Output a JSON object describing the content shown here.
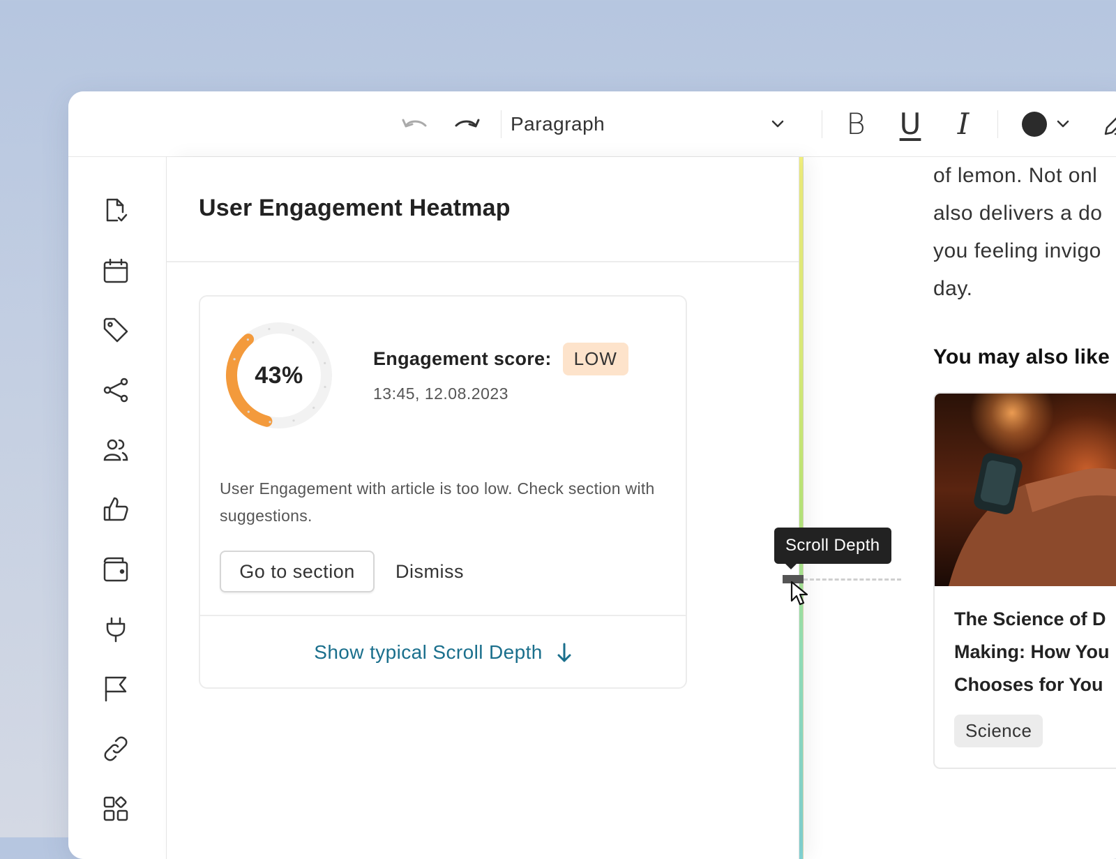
{
  "toolbar": {
    "paragraph_style": "Paragraph",
    "bold_label": "B",
    "underline_label": "U",
    "italic_label": "I",
    "text_color": "#2b2b2b"
  },
  "sidebar": {
    "items": [
      {
        "icon": "document-check-icon"
      },
      {
        "icon": "calendar-icon"
      },
      {
        "icon": "tag-icon"
      },
      {
        "icon": "share-icon"
      },
      {
        "icon": "users-icon"
      },
      {
        "icon": "thumbs-up-icon"
      },
      {
        "icon": "wallet-icon"
      },
      {
        "icon": "plug-icon"
      },
      {
        "icon": "flag-icon"
      },
      {
        "icon": "link-icon"
      },
      {
        "icon": "widgets-icon"
      }
    ]
  },
  "panel": {
    "title": "User Engagement Heatmap",
    "card": {
      "score_percent": 43,
      "score_display": "43%",
      "score_label": "Engagement score:",
      "score_level": "LOW",
      "timestamp": "13:45, 12.08.2023",
      "description": "User Engagement with article is too low. Check section with suggestions.",
      "primary_button": "Go to section",
      "secondary_button": "Dismiss",
      "link_label": "Show typical Scroll Depth",
      "accent_color": "#f39a3c"
    }
  },
  "scroll_depth": {
    "tooltip": "Scroll Depth"
  },
  "article": {
    "lines": [
      "of lemon. Not onl",
      "also delivers a do",
      "you feeling invigo",
      "day."
    ],
    "also_like_heading": "You may also like",
    "recommendation": {
      "title_lines": [
        "The Science of D",
        "Making: How You",
        "Chooses for You"
      ],
      "tag": "Science"
    }
  }
}
